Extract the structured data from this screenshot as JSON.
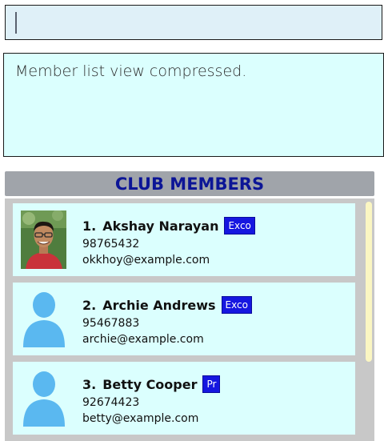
{
  "command_box": {
    "value": ""
  },
  "result_display": {
    "text": "Member list view compressed."
  },
  "member_list": {
    "title": "CLUB MEMBERS",
    "members": [
      {
        "index": "1.",
        "name": "Akshay Narayan",
        "tag": "Exco",
        "phone": "98765432",
        "email": "okkhoy@example.com",
        "avatar": "photo"
      },
      {
        "index": "2.",
        "name": "Archie Andrews",
        "tag": "Exco",
        "phone": "95467883",
        "email": "archie@example.com",
        "avatar": "default-person-icon"
      },
      {
        "index": "3.",
        "name": "Betty Cooper",
        "tag": "Pr",
        "phone": "92674423",
        "email": "betty@example.com",
        "avatar": "default-person-icon"
      }
    ]
  },
  "colors": {
    "tag_bg": "#1616e0",
    "card_bg": "#dbfffe",
    "header_text": "#0c1596",
    "avatar_blue": "#5ab8f0"
  }
}
